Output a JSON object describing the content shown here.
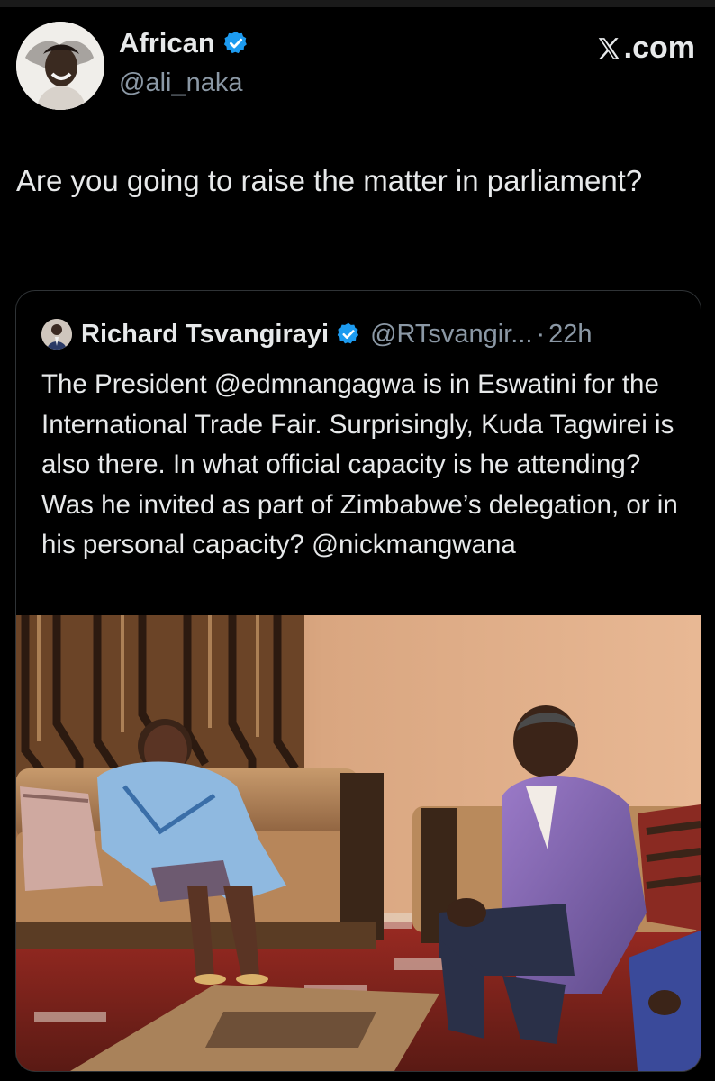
{
  "post": {
    "author_name": "African",
    "author_handle": "@ali_naka",
    "verified": true,
    "avatar_icon": "user-avatar-icon",
    "text": "Are you going to raise the matter in parliament?"
  },
  "brand": {
    "domain": ".com",
    "logo": "x-logo-icon"
  },
  "quoted_post": {
    "author_name": "Richard Tsvangirayi",
    "author_handle": "@RTsvangir...",
    "separator": "·",
    "time": "22h",
    "verified": true,
    "text": "The President @edmnangagwa  is in Eswatini for the International Trade Fair. Surprisingly, Kuda Tagwirei is also there. In what official capacity is he attending? Was he invited as part of Zimbabwe’s delegation, or in his personal capacity? @nickmangwana",
    "image_icon": "photo-meeting-image"
  },
  "colors": {
    "background": "#000000",
    "text_primary": "#e7e9ea",
    "text_secondary": "#8b98a5",
    "verified_blue": "#1d9bf0",
    "border": "#2f3336"
  }
}
